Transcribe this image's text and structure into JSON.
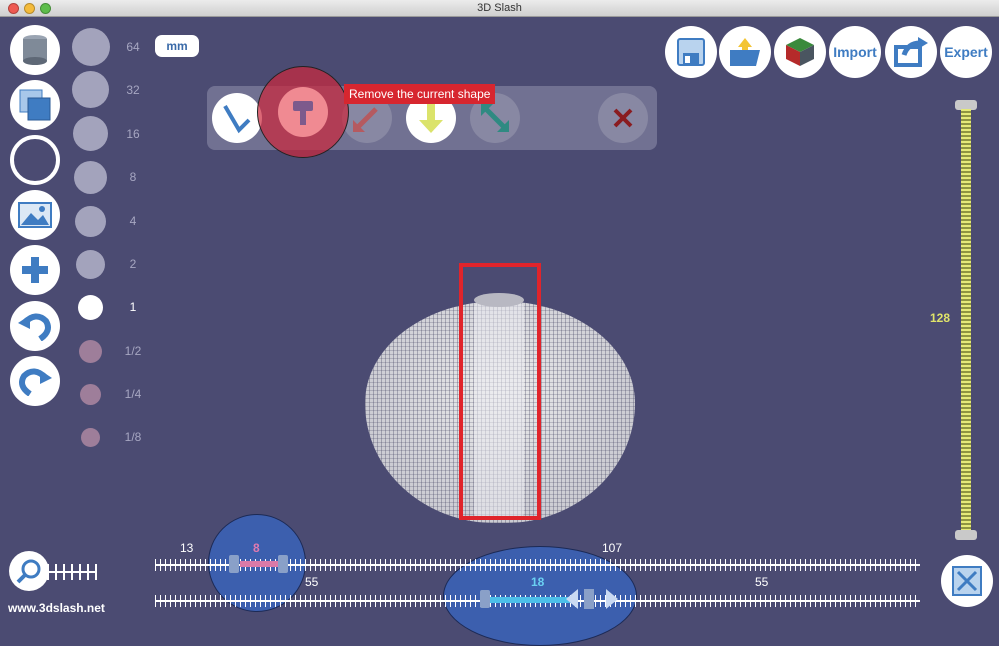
{
  "window": {
    "title": "3D Slash"
  },
  "units": {
    "label": "mm"
  },
  "size_scale": {
    "items": [
      {
        "label": "64"
      },
      {
        "label": "32"
      },
      {
        "label": "16"
      },
      {
        "label": "8"
      },
      {
        "label": "4"
      },
      {
        "label": "2"
      },
      {
        "label": "1"
      },
      {
        "label": "1/2"
      },
      {
        "label": "1/4"
      },
      {
        "label": "1/8"
      }
    ],
    "selected": "1"
  },
  "left_tools": [
    {
      "icon": "cylinder-shape-icon"
    },
    {
      "icon": "layered-cube-icon"
    },
    {
      "icon": "circle-outline-icon"
    },
    {
      "icon": "picture-icon"
    },
    {
      "icon": "plus-icon"
    },
    {
      "icon": "undo-icon"
    },
    {
      "icon": "redo-icon"
    }
  ],
  "shape_toolbar": {
    "tooltip": "Remove the current shape",
    "tools": [
      {
        "icon": "pencil-icon"
      },
      {
        "icon": "hammer-icon"
      },
      {
        "icon": "diagonal-arrow-icon"
      },
      {
        "icon": "down-arrow-icon"
      },
      {
        "icon": "diagonal-arrow-alt-icon"
      },
      {
        "icon": "close-icon"
      }
    ]
  },
  "top_right": {
    "import_label": "Import",
    "expert_label": "Expert"
  },
  "height_slider": {
    "value": "128"
  },
  "bottom": {
    "slider1": {
      "left": "13",
      "value": "8",
      "right": "107"
    },
    "slider2": {
      "left": "55",
      "value": "18",
      "right": "55"
    }
  },
  "footer": {
    "site": "www.3dslash.net"
  },
  "colors": {
    "background": "#4b4b72",
    "accent_blue": "#3f7cc2",
    "highlight_red": "#e0242b",
    "slider_yellow": "#dfe36a"
  }
}
